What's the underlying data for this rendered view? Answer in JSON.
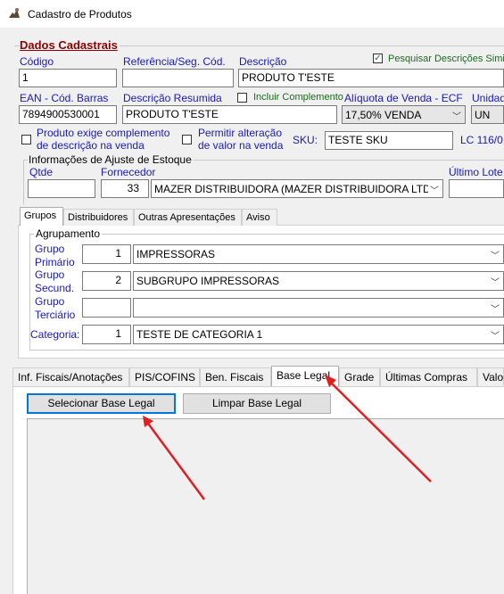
{
  "window": {
    "title": "Cadastro de Produtos"
  },
  "form": {
    "section_title": "Dados Cadastrais",
    "search_descriptions": {
      "label": "Pesquisar Descrições Simi",
      "checked": true
    },
    "codigo": {
      "label": "Código",
      "value": "1"
    },
    "referencia": {
      "label": "Referência/Seg. Cód.",
      "value": ""
    },
    "descricao": {
      "label": "Descrição",
      "value": "PRODUTO T'ESTE"
    },
    "ean": {
      "label": "EAN - Cód. Barras",
      "value": "7894900530001"
    },
    "descricao_resumida": {
      "label": "Descrição Resumida",
      "value": "PRODUTO T'ESTE"
    },
    "incluir_complemento": {
      "label": "Incluir Complemento",
      "checked": false
    },
    "aliquota": {
      "label": "Alíquota de Venda - ECF",
      "value": "17,50% VENDA"
    },
    "unidade": {
      "label": "Unidad",
      "value": "UN"
    },
    "exige_complemento": {
      "label_line1": "Produto exige complemento",
      "label_line2": "de descrição na venda",
      "checked": false
    },
    "permitir_alteracao": {
      "label_line1": "Permitir alteração",
      "label_line2": "de valor na venda",
      "checked": false
    },
    "sku": {
      "label": "SKU:",
      "value": "TESTE SKU"
    },
    "lc": {
      "label": "LC 116/0"
    }
  },
  "estoque": {
    "title": "Informações de Ajuste de Estoque",
    "qtde_label": "Qtde",
    "qtde_value": "",
    "fornecedor_label": "Fornecedor",
    "fornecedor_code": "33",
    "fornecedor_name": "MAZER DISTRIBUIDORA (MAZER DISTRIBUIDORA LTDA",
    "ultimo_lote_label": "Último Lote",
    "ultimo_lote_value": ""
  },
  "upper_tabs": [
    "Grupos",
    "Distribuidores",
    "Outras Apresentações",
    "Aviso"
  ],
  "agrupamento": {
    "title": "Agrupamento",
    "grupo_primario": {
      "label_line1": "Grupo",
      "label_line2": "Primário",
      "code": "1",
      "value": "IMPRESSORAS"
    },
    "grupo_secundario": {
      "label_line1": "Grupo",
      "label_line2": "Secund.",
      "code": "2",
      "value": "SUBGRUPO IMPRESSORAS"
    },
    "grupo_terciario": {
      "label_line1": "Grupo",
      "label_line2": "Terciário",
      "code": "",
      "value": ""
    },
    "categoria": {
      "label": "Categoria:",
      "code": "1",
      "value": "TESTE DE CATEGORIA 1"
    }
  },
  "lower_tabs": [
    "Inf. Fiscais/Anotações",
    "PIS/COFINS",
    "Ben. Fiscais",
    "Base Legal",
    "Grade",
    "Últimas Compras",
    "Valo"
  ],
  "base_legal": {
    "select_button": "Selecionar Base Legal",
    "clear_button": "Limpar Base Legal"
  },
  "colors": {
    "label_blue": "#1a1ab4",
    "section_red": "#8b0000",
    "arrow_red": "#e02020"
  }
}
